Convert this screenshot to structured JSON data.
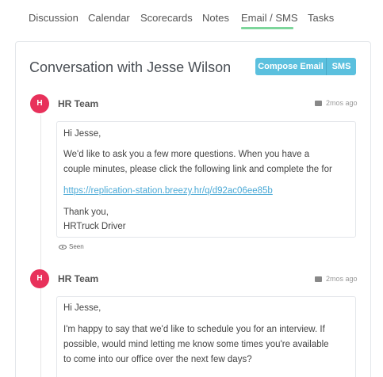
{
  "tabs": {
    "discussion": "Discussion",
    "calendar": "Calendar",
    "scorecards": "Scorecards",
    "notes": "Notes",
    "email_sms": "Email / SMS",
    "tasks": "Tasks"
  },
  "conversation": {
    "title": "Conversation with Jesse Wilson",
    "compose_label": "Compose Email",
    "sms_label": "SMS"
  },
  "messages": [
    {
      "avatar": "H",
      "sender": "HR Team",
      "time": "2mos ago",
      "icon": "mail-icon",
      "greeting": "Hi Jesse,",
      "line1": "We'd like to ask you a few more questions. When you have a",
      "line2": "couple minutes, please click the following link and complete the for",
      "link": "https://replication-station.breezy.hr/q/d92ac06ee85b",
      "signoff": "Thank you,",
      "signature": "HRTruck Driver",
      "status": "Seen"
    },
    {
      "avatar": "H",
      "sender": "HR Team",
      "time": "2mos ago",
      "icon": "mail-icon",
      "greeting": "Hi Jesse,",
      "line1": "I'm happy to say that we'd like to schedule you for an interview. If",
      "line2": "possible, would mind letting me know some times you're available",
      "line3": "to come into our office over the next few days?"
    }
  ],
  "colors": {
    "accent": "#5bc0de",
    "avatar": "#e8315b",
    "active_tab_underline": "#7dd69b",
    "link": "#4aa9d6"
  }
}
